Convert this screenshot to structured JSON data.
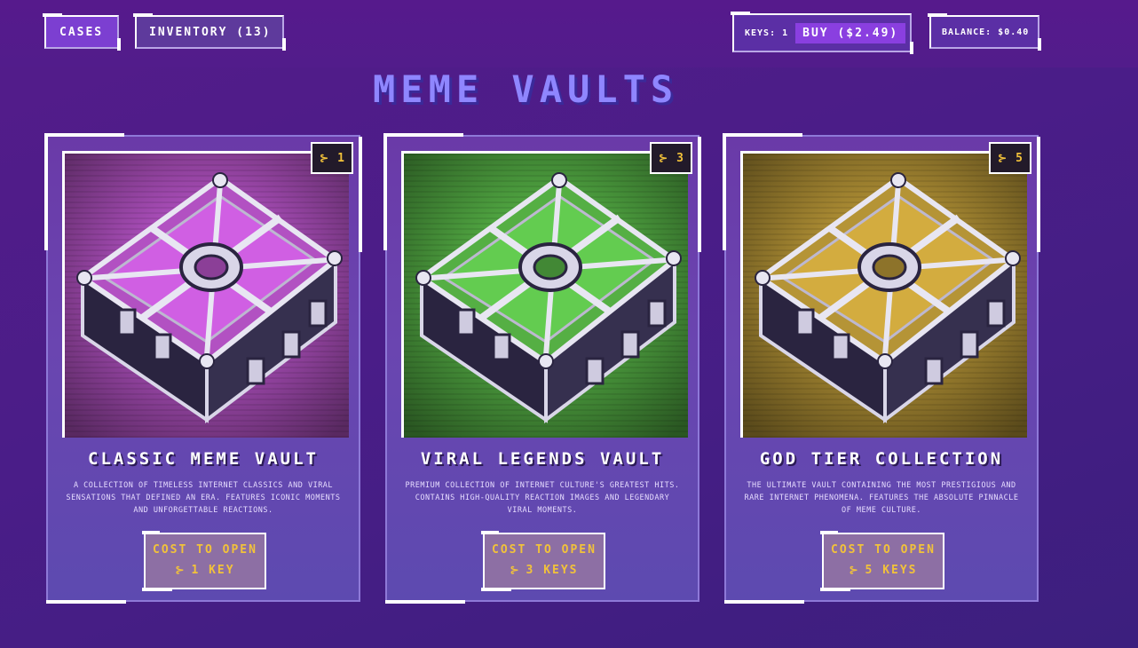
{
  "nav": {
    "cases_label": "CASES",
    "inventory_label": "INVENTORY (13)"
  },
  "wallet": {
    "keys_label": "KEYS: 1",
    "buy_label": "BUY ($2.49)",
    "balance_label": "BALANCE: $0.40"
  },
  "page_title": "MEME VAULTS",
  "cases": [
    {
      "badge": "1",
      "title": "CLASSIC MEME VAULT",
      "description": "A COLLECTION OF TIMELESS INTERNET CLASSICS AND VIRAL SENSATIONS THAT DEFINED AN ERA. FEATURES ICONIC MOMENTS AND UNFORGETTABLE REACTIONS.",
      "cost_label": "COST TO OPEN",
      "cost_value": "1 KEY",
      "color": "#c65ad8"
    },
    {
      "badge": "3",
      "title": "VIRAL LEGENDS VAULT",
      "description": "PREMIUM COLLECTION OF INTERNET CULTURE'S GREATEST HITS. CONTAINS HIGH-QUALITY REACTION IMAGES AND LEGENDARY VIRAL MOMENTS.",
      "cost_label": "COST TO OPEN",
      "cost_value": "3 KEYS",
      "color": "#5ec24c"
    },
    {
      "badge": "5",
      "title": "GOD TIER COLLECTION",
      "description": "THE ULTIMATE VAULT CONTAINING THE MOST PRESTIGIOUS AND RARE INTERNET PHENOMENA. FEATURES THE ABSOLUTE PINNACLE OF MEME CULTURE.",
      "cost_label": "COST TO OPEN",
      "cost_value": "5 KEYS",
      "color": "#c9a43c"
    }
  ],
  "icons": {
    "key": "key-icon"
  }
}
